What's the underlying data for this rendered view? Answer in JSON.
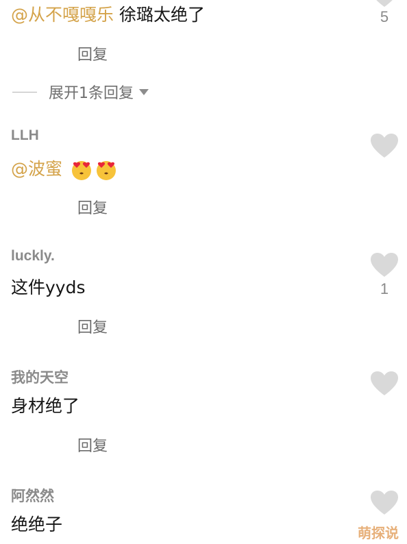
{
  "comments": [
    {
      "mention": "@从不嘎嘎乐",
      "text": " 徐璐太绝了",
      "reply_label": "回复",
      "like_count": "5"
    },
    {
      "username": "LLH",
      "mention": "@波蜜",
      "emoji": "heart-eyes-emoji",
      "reply_label": "回复",
      "like_count": ""
    },
    {
      "username": "luckly.",
      "text": "这件yyds",
      "reply_label": "回复",
      "like_count": "1"
    },
    {
      "username": "我的天空",
      "text": "身材绝了",
      "reply_label": "回复",
      "like_count": ""
    },
    {
      "username": "阿然然",
      "text": "绝绝子",
      "like_count": ""
    }
  ],
  "expand_replies": {
    "label": "展开1条回复",
    "icon": "caret-down-icon"
  },
  "watermark": "萌探说",
  "colors": {
    "mention": "#d4a34a",
    "username": "#8a8a8a",
    "like_icon": "#d9d9d9",
    "watermark": "#e7b07a"
  },
  "icons": {
    "like": "heart-icon"
  }
}
